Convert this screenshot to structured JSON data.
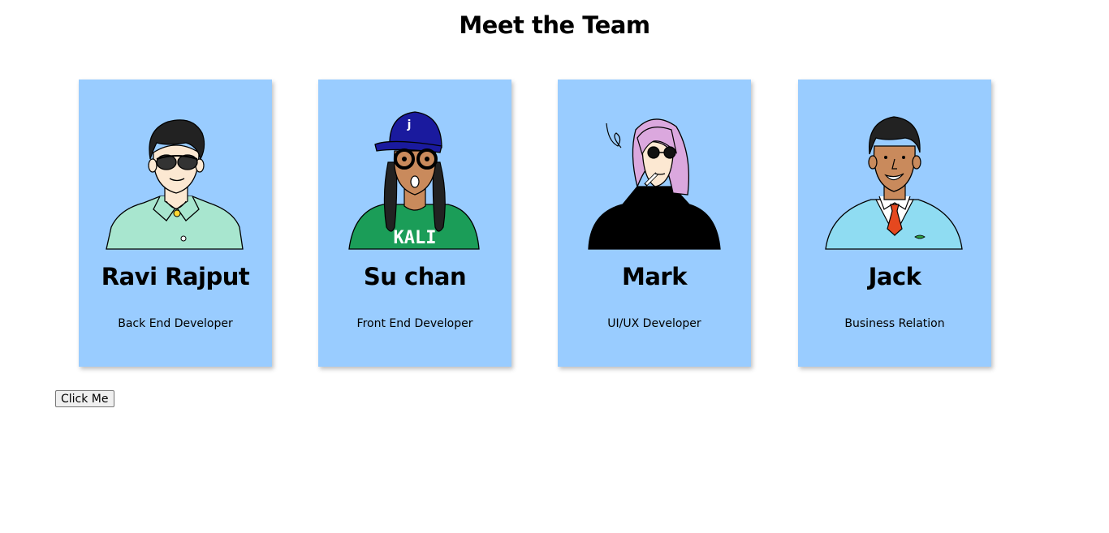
{
  "page": {
    "title": "Meet the Team"
  },
  "team": [
    {
      "name": "Ravi Rajput",
      "role": "Back End Developer",
      "avatar": "man-sunglasses-avatar"
    },
    {
      "name": "Su chan",
      "role": "Front End Developer",
      "avatar": "woman-cap-braids-avatar",
      "shirt_text": "KALI",
      "cap_text": "j"
    },
    {
      "name": "Mark",
      "role": "UI/UX Developer",
      "avatar": "pink-hair-turtleneck-avatar"
    },
    {
      "name": "Jack",
      "role": "Business Relation",
      "avatar": "man-tie-sweater-avatar"
    }
  ],
  "actions": {
    "click_label": "Click Me"
  },
  "colors": {
    "card_background": "#99ccff",
    "background": "#ffffff"
  }
}
